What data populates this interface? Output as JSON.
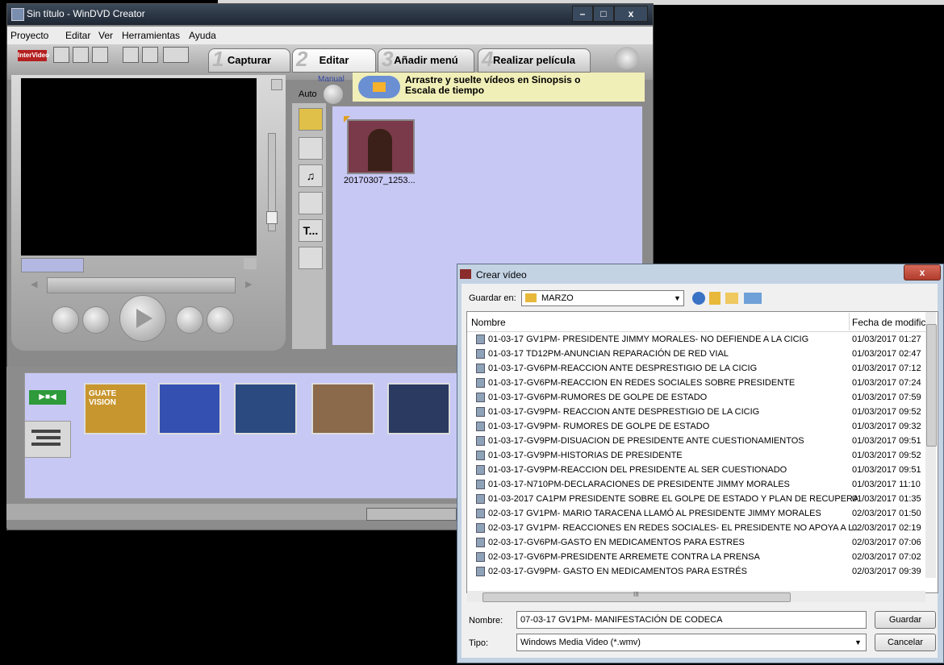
{
  "main": {
    "title": "Sin título - WinDVD Creator",
    "window_buttons": [
      "–",
      "□",
      "x"
    ],
    "menu": [
      "Proyecto",
      "Editar",
      "Ver",
      "Herramientas",
      "Ayuda"
    ],
    "tabs": [
      {
        "num": "1",
        "label": "Capturar"
      },
      {
        "num": "2",
        "label": "Editar"
      },
      {
        "num": "3",
        "label": "Añadir menú"
      },
      {
        "num": "4",
        "label": "Realizar película"
      }
    ],
    "mode_manual": "Manual",
    "mode_auto": "Auto",
    "hint": "Arrastre y suelte vídeos en Sinopsis o Escala de tiempo",
    "clip_label": "20170307_1253...",
    "side_text_icon": "T...",
    "logo_text": "InterVideo",
    "timeline_frame_text": "GUATE VISION"
  },
  "dialog": {
    "title": "Crear vídeo",
    "close": "x",
    "save_in_label": "Guardar en:",
    "save_in_value": "MARZO",
    "col_name": "Nombre",
    "col_date": "Fecha de modific",
    "files": [
      {
        "name": "01-03-17 GV1PM- PRESIDENTE JIMMY MORALES- NO DEFIENDE A LA CICIG",
        "date": "01/03/2017 01:27"
      },
      {
        "name": "01-03-17 TD12PM-ANUNCIAN REPARACIÓN DE RED VIAL",
        "date": "01/03/2017 02:47"
      },
      {
        "name": "01-03-17-GV6PM-REACCION ANTE DESPRESTIGIO DE LA CICIG",
        "date": "01/03/2017 07:12"
      },
      {
        "name": "01-03-17-GV6PM-REACCION EN REDES SOCIALES SOBRE PRESIDENTE",
        "date": "01/03/2017 07:24"
      },
      {
        "name": "01-03-17-GV6PM-RUMORES DE GOLPE DE ESTADO",
        "date": "01/03/2017 07:59"
      },
      {
        "name": "01-03-17-GV9PM- REACCION ANTE DESPRESTIGIO DE LA CICIG",
        "date": "01/03/2017 09:52"
      },
      {
        "name": "01-03-17-GV9PM- RUMORES DE GOLPE DE ESTADO",
        "date": "01/03/2017 09:32"
      },
      {
        "name": "01-03-17-GV9PM-DISUACION DE PRESIDENTE ANTE CUESTIONAMIENTOS",
        "date": "01/03/2017 09:51"
      },
      {
        "name": "01-03-17-GV9PM-HISTORIAS DE PRESIDENTE",
        "date": "01/03/2017 09:52"
      },
      {
        "name": "01-03-17-GV9PM-REACCION DEL PRESIDENTE AL SER CUESTIONADO",
        "date": "01/03/2017 09:51"
      },
      {
        "name": "01-03-17-N710PM-DECLARACIONES DE PRESIDENTE JIMMY MORALES",
        "date": "01/03/2017 11:10"
      },
      {
        "name": "01-03-2017 CA1PM PRESIDENTE SOBRE EL GOLPE DE ESTADO Y PLAN DE RECUPERA...",
        "date": "01/03/2017 01:35"
      },
      {
        "name": "02-03-17 GV1PM- MARIO TARACENA LLAMÓ AL PRESIDENTE JIMMY MORALES",
        "date": "02/03/2017 01:50"
      },
      {
        "name": "02-03-17 GV1PM- REACCIONES EN REDES SOCIALES- EL PRESIDENTE NO APOYA A L...",
        "date": "02/03/2017 02:19"
      },
      {
        "name": "02-03-17-GV6PM-GASTO EN MEDICAMENTOS PARA ESTRES",
        "date": "02/03/2017 07:06"
      },
      {
        "name": "02-03-17-GV6PM-PRESIDENTE ARREMETE CONTRA LA PRENSA",
        "date": "02/03/2017 07:02"
      },
      {
        "name": "02-03-17-GV9PM- GASTO EN MEDICAMENTOS PARA ESTRÉS",
        "date": "02/03/2017 09:39"
      }
    ],
    "hscroll_label": "III",
    "name_label": "Nombre:",
    "name_value": "07-03-17 GV1PM- MANIFESTACIÓN DE CODECA",
    "type_label": "Tipo:",
    "type_value": "Windows Media Video (*.wmv)",
    "save_button": "Guardar",
    "cancel_button": "Cancelar"
  }
}
